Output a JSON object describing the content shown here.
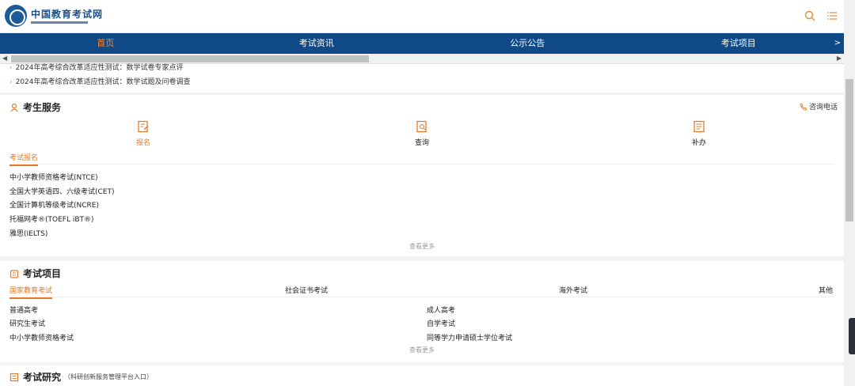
{
  "header": {
    "logo_text": "中国教育考试网",
    "icons": [
      "search-icon",
      "menu-list-icon"
    ]
  },
  "nav": {
    "items": [
      "首页",
      "考试资讯",
      "公示公告",
      "考试项目"
    ],
    "more": ">"
  },
  "news": {
    "lines": [
      "2024年高考综合改革适应性测试：数学试卷专家点评",
      "2024年高考综合改革适应性测试：数学试题及问卷调查"
    ]
  },
  "services": {
    "title": "考生服务",
    "consult": "咨询电话",
    "buttons": [
      "报名",
      "查询",
      "补办"
    ],
    "tab": "考试报名",
    "items": [
      "中小学教师资格考试(NTCE)",
      "全国大学英语四、六级考试(CET)",
      "全国计算机等级考试(NCRE)",
      "托福网考®(TOEFL iBT®)",
      "雅思(IELTS)"
    ],
    "more": "查看更多"
  },
  "projects": {
    "title": "考试项目",
    "tabs": [
      "国家教育考试",
      "社会证书考试",
      "海外考试",
      "其他"
    ],
    "left": [
      "普通高考",
      "研究生考试",
      "中小学教师资格考试"
    ],
    "right": [
      "成人高考",
      "自学考试",
      "同等学力申请硕士学位考试"
    ],
    "more": "查看更多"
  },
  "research": {
    "title": "考试研究",
    "subtitle": "（科研创新服务管理平台入口）"
  },
  "colors": {
    "nav_bg": "#104a86",
    "accent": "#e37b2d"
  }
}
